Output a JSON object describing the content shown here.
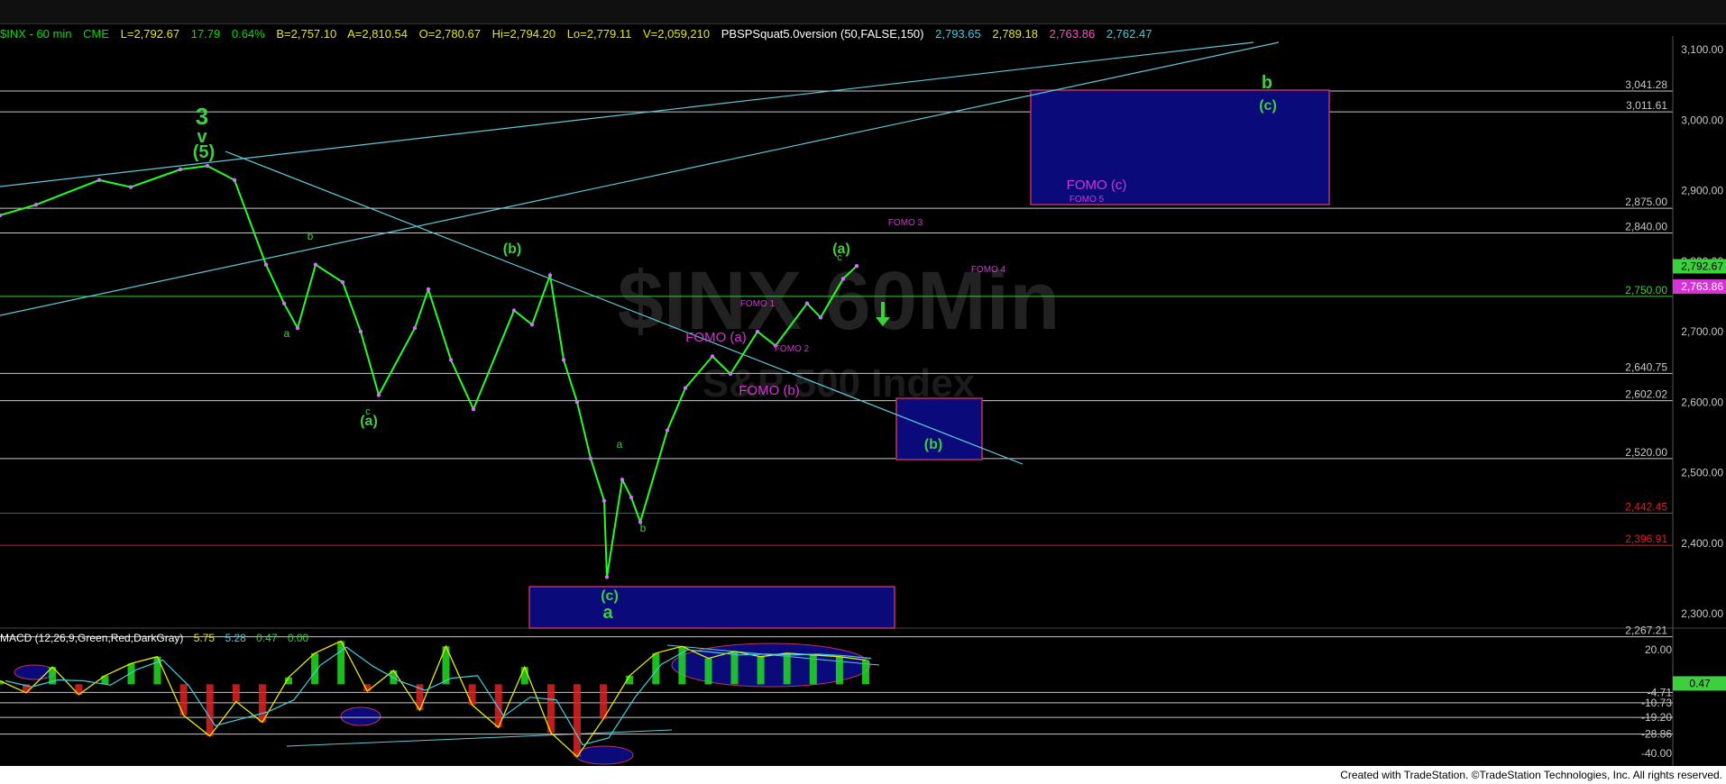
{
  "header": {
    "symbol": "$INX - 60 min",
    "exchange": "CME",
    "last": "L=2,792.67",
    "change": "17.79",
    "change_pct": "0.64%",
    "bid": "B=2,757.10",
    "ask": "A=2,810.54",
    "open": "O=2,780.67",
    "high": "Hi=2,794.20",
    "low": "Lo=2,779.11",
    "volume": "V=2,059,210",
    "indicator": "PBSPSquat5.0version (50,FALSE,150)",
    "ind_v1": "2,793.65",
    "ind_v2": "2,789.18",
    "ind_v3": "2,763.86",
    "ind_v4": "2,762.47"
  },
  "watermark": {
    "line1": "$INX 60Min",
    "line2": "S&P 500 Index"
  },
  "price_axis": {
    "ticks": [
      "3,100.00",
      "3,000.00",
      "2,900.00",
      "2,800.00",
      "2,700.00",
      "2,600.00",
      "2,500.00",
      "2,400.00",
      "2,300.00"
    ],
    "tick_values": [
      3100,
      3000,
      2900,
      2800,
      2700,
      2600,
      2500,
      2400,
      2300
    ],
    "badge_last": "2,792.67",
    "badge_last_value": 2792.67,
    "badge_ind": "2,763.86",
    "badge_ind_value": 2763.86
  },
  "levels": [
    {
      "label": "3,041.28",
      "value": 3041.28,
      "color": "#c8c8c8"
    },
    {
      "label": "3,011.61",
      "value": 3011.61,
      "color": "#c8c8c8"
    },
    {
      "label": "2,875.00",
      "value": 2875.0,
      "color": "#c8c8c8"
    },
    {
      "label": "2,840.00",
      "value": 2840.0,
      "color": "#c8c8c8"
    },
    {
      "label": "2,750.00",
      "value": 2750.0,
      "color": "#3ecf3e"
    },
    {
      "label": "2,640.75",
      "value": 2640.75,
      "color": "#c8c8c8"
    },
    {
      "label": "2,602.02",
      "value": 2602.02,
      "color": "#c8c8c8"
    },
    {
      "label": "2,520.00",
      "value": 2520.0,
      "color": "#c8c8c8"
    },
    {
      "label": "2,442.45",
      "value": 2442.45,
      "color": "#e02020"
    },
    {
      "label": "2,396.91",
      "value": 2396.91,
      "color": "#e02020"
    },
    {
      "label": "2,267.21",
      "value": 2267.21,
      "color": "#c8c8c8"
    }
  ],
  "wave_labels": [
    {
      "text": "3",
      "color": "#3ecf3e",
      "size": 26
    },
    {
      "text": "v",
      "color": "#3ecf3e",
      "size": 20
    },
    {
      "text": "(5)",
      "color": "#3ecf3e",
      "size": 20
    },
    {
      "text": "b",
      "color": "#3ecf3e",
      "size": 12
    },
    {
      "text": "a",
      "color": "#3ecf3e",
      "size": 12
    },
    {
      "text": "c",
      "color": "#3ecf3e",
      "size": 11
    },
    {
      "text": "(a)",
      "color": "#3ecf3e",
      "size": 16
    },
    {
      "text": "(b)",
      "color": "#3ecf3e",
      "size": 16
    },
    {
      "text": "a",
      "color": "#3ecf3e",
      "size": 12
    },
    {
      "text": "b",
      "color": "#3ecf3e",
      "size": 12
    },
    {
      "text": "(c)",
      "color": "#3ecf3e",
      "size": 16
    },
    {
      "text": "a",
      "color": "#3ecf3e",
      "size": 20
    },
    {
      "text": "(a)",
      "color": "#3ecf3e",
      "size": 16
    },
    {
      "text": "c",
      "color": "#3ecf3e",
      "size": 11
    },
    {
      "text": "b",
      "color": "#3ecf3e",
      "size": 20
    },
    {
      "text": "(c)",
      "color": "#3ecf3e",
      "size": 16
    },
    {
      "text": "(b)",
      "color": "#3ecf3e",
      "size": 16
    },
    {
      "text": "FOMO (a)",
      "color": "#d633d6",
      "size": 15
    },
    {
      "text": "FOMO (b)",
      "color": "#d633d6",
      "size": 15
    },
    {
      "text": "FOMO 1",
      "color": "#d633d6",
      "size": 10
    },
    {
      "text": "FOMO 2",
      "color": "#d633d6",
      "size": 10
    },
    {
      "text": "FOMO 3",
      "color": "#d633d6",
      "size": 10
    },
    {
      "text": "FOMO 4",
      "color": "#d633d6",
      "size": 10
    },
    {
      "text": "FOMO (c)",
      "color": "#d633d6",
      "size": 15
    },
    {
      "text": "FOMO 5",
      "color": "#d633d6",
      "size": 10
    }
  ],
  "macd": {
    "title": "MACD (12,26,9,Green,Red,DarkGray)",
    "v1": "5.75",
    "v2": "5.28",
    "v3": "0.47",
    "v4": "0.00",
    "ticks": [
      "20.00",
      "-4.71",
      "-10.73",
      "-19.20",
      "-28.86",
      "-40.00"
    ],
    "tick_values": [
      20.0,
      -4.71,
      -10.73,
      -19.2,
      -28.86,
      -40.0
    ],
    "badge": "0.47",
    "badge_value": 0.47
  },
  "footer": {
    "text": "Created with TradeStation. ©TradeStation Technologies, Inc. All rights reserved."
  },
  "chart_data": {
    "type": "line",
    "title": "$INX - 60 min",
    "series": [
      {
        "name": "$INX",
        "values": [
          2865,
          2880,
          2915,
          2905,
          2930,
          2935,
          2915,
          2795,
          2740,
          2705,
          2795,
          2770,
          2700,
          2610,
          2705,
          2760,
          2660,
          2590,
          2730,
          2710,
          2780,
          2660,
          2600,
          2520,
          2460,
          2352,
          2490,
          2465,
          2430,
          2560,
          2620,
          2665,
          2640,
          2700,
          2680,
          2740,
          2720,
          2775,
          2793
        ]
      },
      {
        "name": "MACD",
        "values": [
          2,
          -5,
          10,
          -6,
          5,
          12,
          16,
          -18,
          -30,
          -10,
          -22,
          4,
          18,
          25,
          -4,
          8,
          -15,
          22,
          -12,
          -25,
          10,
          -28,
          -42,
          -20,
          5,
          18,
          22,
          15,
          19,
          16,
          18,
          17,
          16,
          14
        ]
      }
    ],
    "ylim": [
      2250,
      3120
    ],
    "macd_ylim": [
      -45,
      25
    ],
    "annotations": [
      "FOMO (a)",
      "FOMO (b)",
      "FOMO 1",
      "FOMO 2",
      "FOMO 3",
      "FOMO 4",
      "FOMO (c)",
      "FOMO 5"
    ],
    "grid": true
  }
}
